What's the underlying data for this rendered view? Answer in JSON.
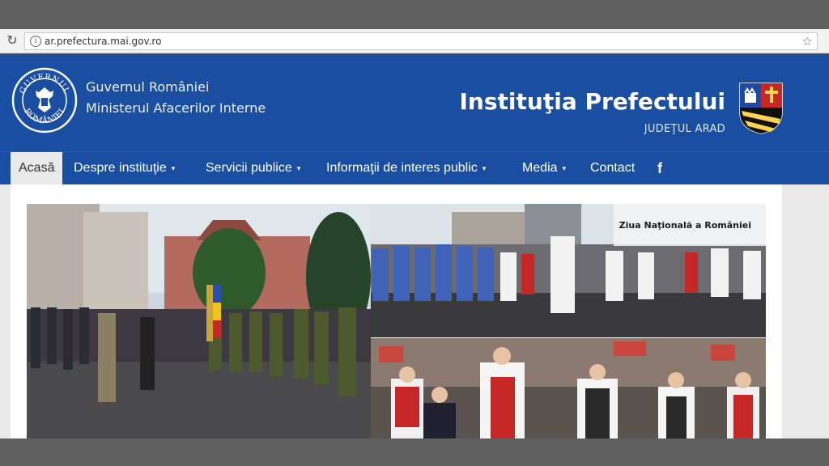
{
  "browser": {
    "url": "ar.prefectura.mai.gov.ro",
    "reload_icon": "reload-icon",
    "info_icon": "info-icon",
    "bookmark_icon": "star-icon"
  },
  "header": {
    "seal_text_top": "GUVERNUL",
    "seal_text_bottom": "ROMÂNIEI",
    "government": "Guvernul României",
    "ministry": "Ministerul Afacerilor Interne",
    "institution": "Instituţia Prefectului",
    "county": "JUDEŢUL ARAD"
  },
  "nav": {
    "items": [
      {
        "label": "Acasă",
        "active": true
      },
      {
        "label": "Despre instituţie",
        "dropdown": true
      },
      {
        "label": "Servicii publice",
        "dropdown": true
      },
      {
        "label": "Informaţii de interes public",
        "dropdown": true
      },
      {
        "label": "Media",
        "dropdown": true
      },
      {
        "label": "Contact"
      }
    ],
    "caret": "▾",
    "facebook": "f"
  },
  "gallery": {
    "caption": "Ziua Naţională a României"
  },
  "colors": {
    "header_blue": "#1a4ea0",
    "nav_active_bg": "#e9e9e9"
  }
}
